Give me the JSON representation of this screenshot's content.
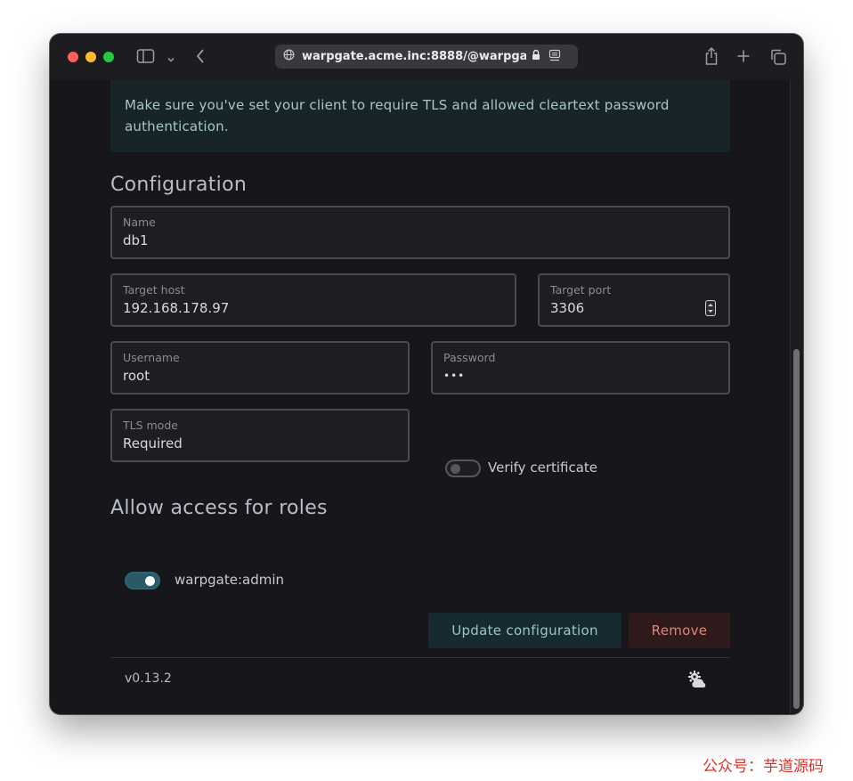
{
  "browser": {
    "url": "warpgate.acme.inc:8888/@warpgate/admin",
    "traffic_light_colors": [
      "#fe5f57",
      "#febc2e",
      "#28c840"
    ]
  },
  "alert": {
    "text": "Make sure you've set your client to require TLS and allowed cleartext password authentication."
  },
  "configuration": {
    "heading": "Configuration",
    "name": {
      "label": "Name",
      "value": "db1"
    },
    "target_host": {
      "label": "Target host",
      "value": "192.168.178.97"
    },
    "target_port": {
      "label": "Target port",
      "value": "3306"
    },
    "username": {
      "label": "Username",
      "value": "root"
    },
    "password": {
      "label": "Password",
      "value": "•••"
    },
    "tls_mode": {
      "label": "TLS mode",
      "value": "Required"
    },
    "verify_certificate": {
      "label": "Verify certificate",
      "enabled": false
    }
  },
  "roles": {
    "heading": "Allow access for roles",
    "items": [
      {
        "label": "warpgate:admin",
        "enabled": true
      }
    ]
  },
  "actions": {
    "update_label": "Update configuration",
    "remove_label": "Remove"
  },
  "footer": {
    "version": "v0.13.2",
    "theme_icon": "gear-cloud-icon"
  },
  "watermark": "公众号：芋道源码",
  "colors": {
    "accent": "#295a66",
    "update_button_bg": "#172a2f",
    "update_button_text": "#9cc4cc",
    "remove_button_bg": "#2e1a1a",
    "remove_button_text": "#e0857a"
  }
}
